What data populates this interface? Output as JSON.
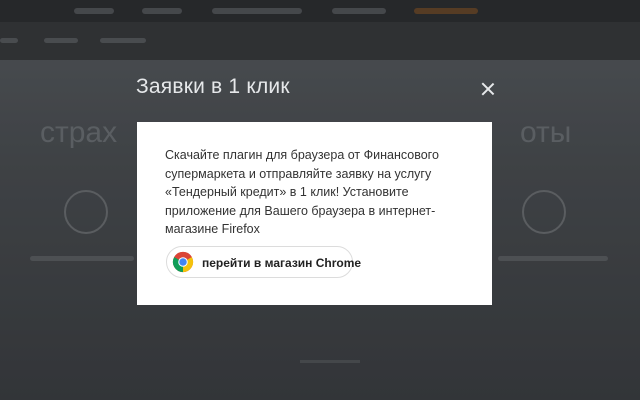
{
  "modal": {
    "title": "Заявки в 1 клик",
    "close_icon": "close-icon",
    "body_text": "Скачайте плагин для браузера от Финансового супермаркета и отправляйте заявку на услугу «Тендерный кредит» в 1 клик! Установите приложение для Вашего браузера в интернет-магазине Firefox",
    "store_button_label": "перейти в магазин Chrome",
    "store_icon": "chrome-icon"
  },
  "colors": {
    "modal_bg": "#ffffff",
    "title_color": "#e6e8ea",
    "text_color": "#333333"
  }
}
